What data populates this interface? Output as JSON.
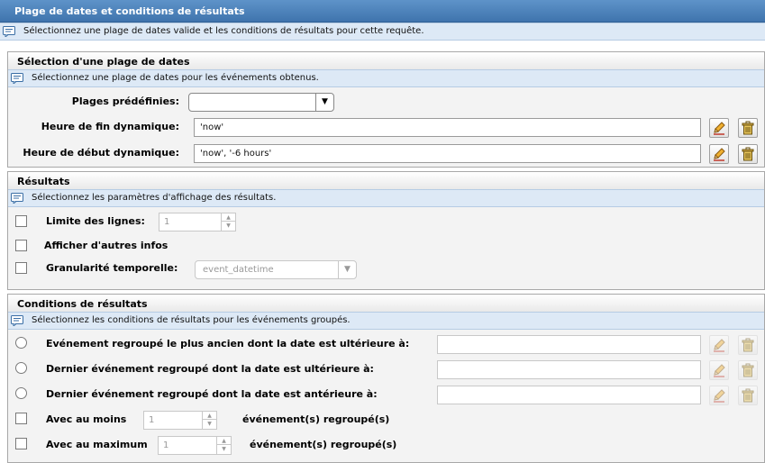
{
  "window": {
    "title": "Plage de dates et conditions de résultats",
    "hint": "Sélectionnez une plage de dates valide et les conditions de résultats pour cette requête."
  },
  "date_range": {
    "title": "Sélection d'une plage de dates",
    "hint": "Sélectionnez une plage de dates pour les événements obtenus.",
    "predefined_label": "Plages prédéfinies:",
    "predefined_value": "",
    "end_label": "Heure de fin dynamique:",
    "end_value": "'now'",
    "start_label": "Heure de début dynamique:",
    "start_value": "'now', '-6 hours'"
  },
  "results": {
    "title": "Résultats",
    "hint": "Sélectionnez les paramètres d'affichage des résultats.",
    "limit_label": "Limite des lignes:",
    "limit_value": "1",
    "other_info_label": "Afficher d'autres infos",
    "granularity_label": "Granularité temporelle:",
    "granularity_value": "event_datetime"
  },
  "conditions": {
    "title": "Conditions de résultats",
    "hint": "Sélectionnez les conditions de résultats pour les événements groupés.",
    "oldest_after_label": "Evénement regroupé le plus ancien dont la date est ultérieure à:",
    "last_after_label": "Dernier événement regroupé dont la date est ultérieure à:",
    "last_before_label": "Dernier événement regroupé dont la date est antérieure à:",
    "at_least_label": "Avec au moins",
    "at_least_value": "1",
    "at_least_suffix": "événement(s) regroupé(s)",
    "at_most_label": "Avec au maximum",
    "at_most_value": "1",
    "at_most_suffix": "événement(s) regroupé(s)"
  },
  "icons": {
    "hint": "info-note-icon",
    "edit": "pencil-icon",
    "delete": "trash-icon"
  }
}
